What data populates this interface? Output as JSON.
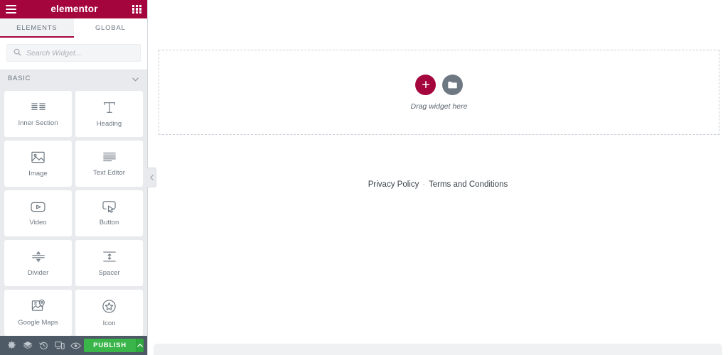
{
  "panel": {
    "header": {
      "menu_icon": "hamburger-icon",
      "brand": "elementor",
      "apps_icon": "apps-grid-icon"
    },
    "tabs": [
      {
        "label": "ELEMENTS",
        "active": true
      },
      {
        "label": "GLOBAL",
        "active": false
      }
    ],
    "search": {
      "icon": "search-icon",
      "placeholder": "Search Widget...",
      "value": ""
    },
    "category": {
      "label": "BASIC",
      "chevron_icon": "chevron-down-icon",
      "expanded": true
    },
    "widgets": [
      {
        "label": "Inner Section",
        "icon": "columns-icon"
      },
      {
        "label": "Heading",
        "icon": "text-heading-icon"
      },
      {
        "label": "Image",
        "icon": "image-icon"
      },
      {
        "label": "Text Editor",
        "icon": "text-lines-icon"
      },
      {
        "label": "Video",
        "icon": "video-play-icon"
      },
      {
        "label": "Button",
        "icon": "button-cursor-icon"
      },
      {
        "label": "Divider",
        "icon": "divider-icon"
      },
      {
        "label": "Spacer",
        "icon": "spacer-icon"
      },
      {
        "label": "Google Maps",
        "icon": "map-pin-icon"
      },
      {
        "label": "Icon",
        "icon": "star-circle-icon"
      }
    ],
    "footer": {
      "tools": [
        {
          "name": "settings-icon",
          "title": "Settings"
        },
        {
          "name": "navigator-layers-icon",
          "title": "Navigator"
        },
        {
          "name": "history-icon",
          "title": "History"
        },
        {
          "name": "responsive-mode-icon",
          "title": "Responsive Mode"
        },
        {
          "name": "preview-eye-icon",
          "title": "Preview Changes"
        }
      ],
      "publish_label": "PUBLISH",
      "publish_caret_icon": "caret-up-icon"
    },
    "collapse_handle_icon": "chevron-left-icon"
  },
  "canvas": {
    "drop_zone": {
      "add_section_icon": "plus-icon",
      "add_template_icon": "folder-icon",
      "label": "Drag widget here"
    },
    "site_footer": {
      "privacy_label": "Privacy Policy",
      "separator": "·",
      "terms_label": "Terms and Conditions"
    }
  },
  "colors": {
    "brand_crimson": "#a4053c",
    "panel_bg": "#e8eaed",
    "toolbar_bg": "#4e5a65",
    "publish_green": "#39b54a",
    "icon_gray": "#6d7882",
    "text_dark": "#3b424a"
  }
}
